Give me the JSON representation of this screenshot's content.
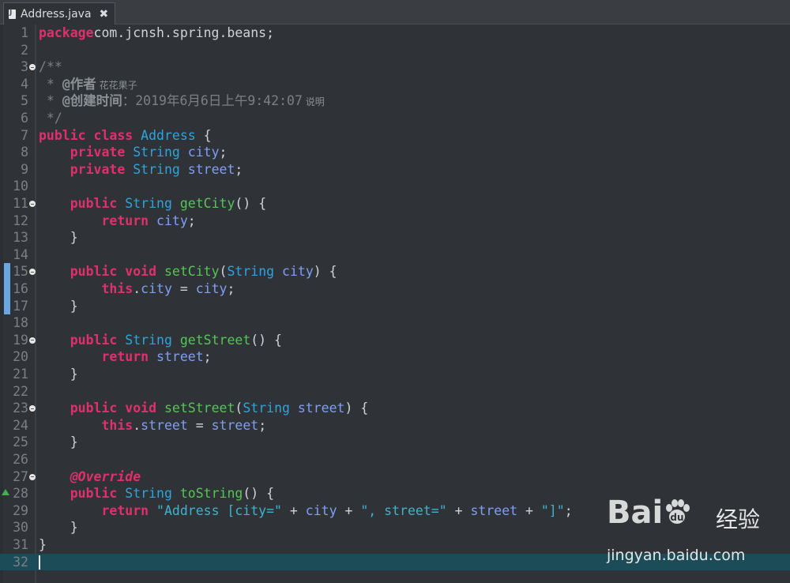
{
  "tab": {
    "title": "Address.java",
    "close_glyph": "✖"
  },
  "lines": [
    {
      "n": "1",
      "segs": [
        [
          "kw",
          "package"
        ],
        [
          "",
          "com.jcnsh.spring.beans;"
        ]
      ]
    },
    {
      "n": "2",
      "segs": []
    },
    {
      "n": "3",
      "fold": true,
      "segs": [
        [
          "comment",
          "/**"
        ]
      ]
    },
    {
      "n": "4",
      "segs": [
        [
          "comment",
          " * "
        ],
        [
          "tag",
          "@作者"
        ],
        [
          "cn",
          " 花花果子"
        ]
      ]
    },
    {
      "n": "5",
      "segs": [
        [
          "comment",
          " * "
        ],
        [
          "tag",
          "@创建时间"
        ],
        [
          "comment",
          "："
        ],
        [
          "comment",
          "2019年6月6日上午9:42:07"
        ],
        [
          "cn",
          " 说明"
        ]
      ]
    },
    {
      "n": "6",
      "segs": [
        [
          "comment",
          " */"
        ]
      ]
    },
    {
      "n": "7",
      "segs": [
        [
          "kw",
          "public"
        ],
        [
          "",
          " "
        ],
        [
          "kw",
          "class"
        ],
        [
          "",
          " "
        ],
        [
          "ty",
          "Address"
        ],
        [
          "",
          " {"
        ]
      ]
    },
    {
      "n": "8",
      "segs": [
        [
          "",
          " "
        ],
        [
          "kw",
          "private"
        ],
        [
          "",
          " "
        ],
        [
          "ty",
          "String"
        ],
        [
          "",
          " "
        ],
        [
          "field",
          "city"
        ],
        [
          "",
          ";"
        ]
      ]
    },
    {
      "n": "9",
      "segs": [
        [
          "",
          " "
        ],
        [
          "kw",
          "private"
        ],
        [
          "",
          " "
        ],
        [
          "ty",
          "String"
        ],
        [
          "",
          " "
        ],
        [
          "field",
          "street"
        ],
        [
          "",
          ";"
        ]
      ]
    },
    {
      "n": "10",
      "segs": []
    },
    {
      "n": "11",
      "fold": true,
      "segs": [
        [
          "",
          " "
        ],
        [
          "kw",
          "public"
        ],
        [
          "",
          " "
        ],
        [
          "ty",
          "String"
        ],
        [
          "",
          " "
        ],
        [
          "fn",
          "getCity"
        ],
        [
          "",
          "() {"
        ]
      ]
    },
    {
      "n": "12",
      "segs": [
        [
          "",
          " "
        ],
        [
          "kw",
          "return"
        ],
        [
          "",
          " "
        ],
        [
          "field",
          "city"
        ],
        [
          "",
          ";"
        ]
      ]
    },
    {
      "n": "13",
      "segs": [
        [
          "",
          " }"
        ]
      ]
    },
    {
      "n": "14",
      "segs": []
    },
    {
      "n": "15",
      "fold": true,
      "changed": true,
      "segs": [
        [
          "",
          " "
        ],
        [
          "kw",
          "public"
        ],
        [
          "",
          " "
        ],
        [
          "kw",
          "void"
        ],
        [
          "",
          " "
        ],
        [
          "fn",
          "setCity"
        ],
        [
          "",
          "("
        ],
        [
          "ty",
          "String"
        ],
        [
          "",
          " "
        ],
        [
          "param",
          "city"
        ],
        [
          "",
          ") {"
        ]
      ]
    },
    {
      "n": "16",
      "changed": true,
      "segs": [
        [
          "",
          " "
        ],
        [
          "kw",
          "this"
        ],
        [
          "",
          "."
        ],
        [
          "field",
          "city"
        ],
        [
          "",
          " = "
        ],
        [
          "param",
          "city"
        ],
        [
          "",
          ";"
        ]
      ]
    },
    {
      "n": "17",
      "changed": true,
      "segs": [
        [
          "",
          " }"
        ]
      ]
    },
    {
      "n": "18",
      "segs": []
    },
    {
      "n": "19",
      "fold": true,
      "segs": [
        [
          "",
          " "
        ],
        [
          "kw",
          "public"
        ],
        [
          "",
          " "
        ],
        [
          "ty",
          "String"
        ],
        [
          "",
          " "
        ],
        [
          "fn",
          "getStreet"
        ],
        [
          "",
          "() {"
        ]
      ]
    },
    {
      "n": "20",
      "segs": [
        [
          "",
          " "
        ],
        [
          "kw",
          "return"
        ],
        [
          "",
          " "
        ],
        [
          "field",
          "street"
        ],
        [
          "",
          ";"
        ]
      ]
    },
    {
      "n": "21",
      "segs": [
        [
          "",
          " }"
        ]
      ]
    },
    {
      "n": "22",
      "segs": []
    },
    {
      "n": "23",
      "fold": true,
      "segs": [
        [
          "",
          " "
        ],
        [
          "kw",
          "public"
        ],
        [
          "",
          " "
        ],
        [
          "kw",
          "void"
        ],
        [
          "",
          " "
        ],
        [
          "fn",
          "setStreet"
        ],
        [
          "",
          "("
        ],
        [
          "ty",
          "String"
        ],
        [
          "",
          " "
        ],
        [
          "param",
          "street"
        ],
        [
          "",
          ") {"
        ]
      ]
    },
    {
      "n": "24",
      "segs": [
        [
          "",
          " "
        ],
        [
          "kw",
          "this"
        ],
        [
          "",
          "."
        ],
        [
          "field",
          "street"
        ],
        [
          "",
          " = "
        ],
        [
          "param",
          "street"
        ],
        [
          "",
          ";"
        ]
      ]
    },
    {
      "n": "25",
      "segs": [
        [
          "",
          " }"
        ]
      ]
    },
    {
      "n": "26",
      "segs": []
    },
    {
      "n": "27",
      "fold": true,
      "segs": [
        [
          "",
          " "
        ],
        [
          "anno",
          "@Override"
        ]
      ]
    },
    {
      "n": "28",
      "override": true,
      "segs": [
        [
          "",
          " "
        ],
        [
          "kw",
          "public"
        ],
        [
          "",
          " "
        ],
        [
          "ty",
          "String"
        ],
        [
          "",
          " "
        ],
        [
          "fn",
          "toString"
        ],
        [
          "",
          "() {"
        ]
      ]
    },
    {
      "n": "29",
      "segs": [
        [
          "",
          " "
        ],
        [
          "kw",
          "return"
        ],
        [
          "",
          " "
        ],
        [
          "str",
          "\"Address [city=\""
        ],
        [
          "",
          " + "
        ],
        [
          "field",
          "city"
        ],
        [
          "",
          " + "
        ],
        [
          "str",
          "\", street=\""
        ],
        [
          "",
          " + "
        ],
        [
          "field",
          "street"
        ],
        [
          "",
          " + "
        ],
        [
          "str",
          "\"]\""
        ],
        [
          "",
          ";"
        ]
      ]
    },
    {
      "n": "30",
      "segs": [
        [
          "",
          " }"
        ]
      ]
    },
    {
      "n": "31",
      "segs": [
        [
          "",
          "}"
        ]
      ]
    },
    {
      "n": "32",
      "current": true,
      "segs": []
    }
  ],
  "watermark": {
    "logo": "Bai",
    "logo_tail": "",
    "cn": "经验",
    "url": "jingyan.baidu.com"
  }
}
